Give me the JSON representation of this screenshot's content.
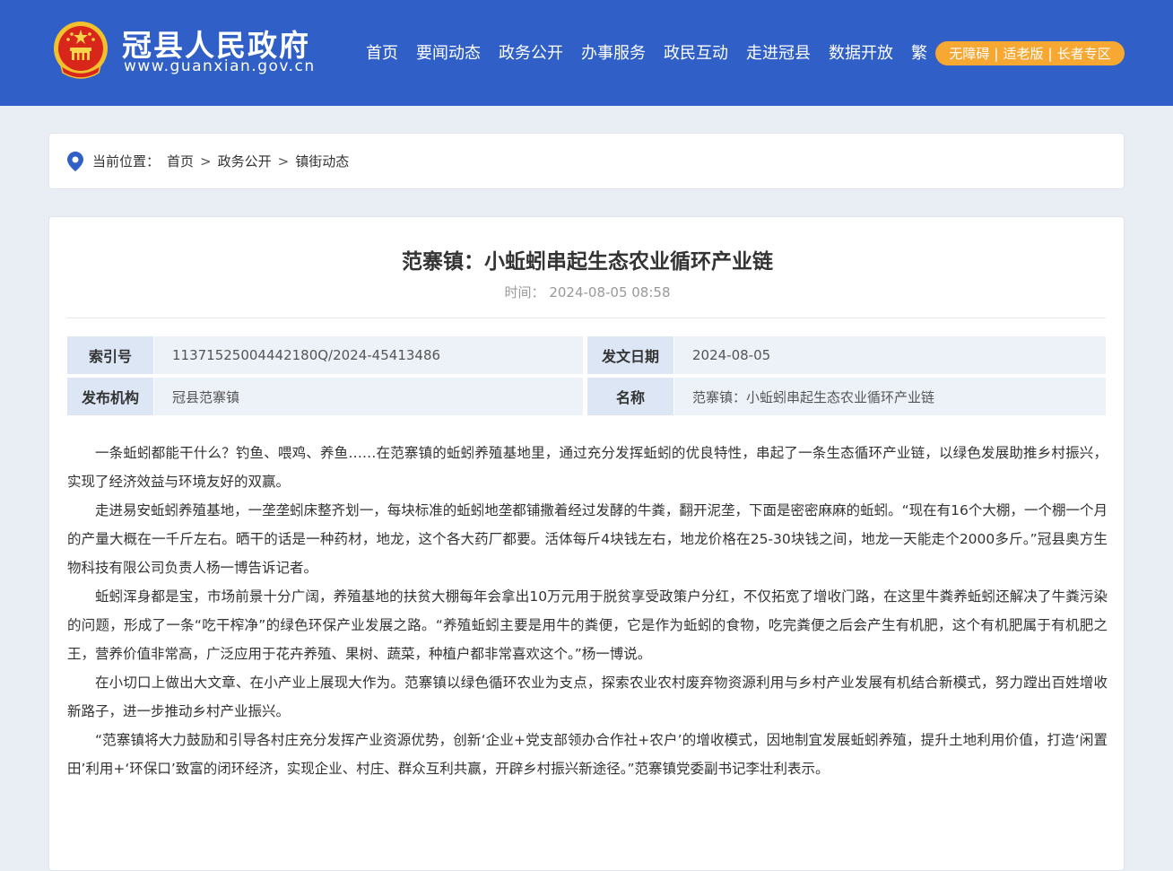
{
  "header": {
    "site_name": "冠县人民政府",
    "site_url": "www.guanxian.gov.cn",
    "nav": [
      "首页",
      "要闻动态",
      "政务公开",
      "办事服务",
      "政民互动",
      "走进冠县",
      "数据开放",
      "繁"
    ],
    "access": [
      "无障碍",
      "适老版",
      "长者专区"
    ],
    "access_sep": "|"
  },
  "breadcrumb": {
    "prefix": "当前位置：",
    "items": [
      "首页",
      "政务公开",
      "镇街动态"
    ],
    "sep": ">"
  },
  "article": {
    "title": "范寨镇：小蚯蚓串起生态农业循环产业链",
    "time_label": "时间：",
    "time_value": "2024-08-05 08:58",
    "meta": {
      "index_label": "索引号",
      "index_value": "11371525004442180Q/2024-45413486",
      "date_label": "发文日期",
      "date_value": "2024-08-05",
      "org_label": "发布机构",
      "org_value": "冠县范寨镇",
      "name_label": "名称",
      "name_value": "范寨镇：小蚯蚓串起生态农业循环产业链"
    },
    "paragraphs": [
      "一条蚯蚓都能干什么？钓鱼、喂鸡、养鱼……在范寨镇的蚯蚓养殖基地里，通过充分发挥蚯蚓的优良特性，串起了一条生态循环产业链，以绿色发展助推乡村振兴，实现了经济效益与环境友好的双赢。",
      "走进易安蚯蚓养殖基地，一垄垄蚓床整齐划一，每块标准的蚯蚓地垄都铺撒着经过发酵的牛粪，翻开泥垄，下面是密密麻麻的蚯蚓。“现在有16个大棚，一个棚一个月的产量大概在一千斤左右。晒干的话是一种药材，地龙，这个各大药厂都要。活体每斤4块钱左右，地龙价格在25-30块钱之间，地龙一天能走个2000多斤。”冠县奥方生物科技有限公司负责人杨一博告诉记者。",
      "蚯蚓浑身都是宝，市场前景十分广阔，养殖基地的扶贫大棚每年会拿出10万元用于脱贫享受政策户分红，不仅拓宽了增收门路，在这里牛粪养蚯蚓还解决了牛粪污染的问题，形成了一条“吃干榨净”的绿色环保产业发展之路。“养殖蚯蚓主要是用牛的粪便，它是作为蚯蚓的食物，吃完粪便之后会产生有机肥，这个有机肥属于有机肥之王，营养价值非常高，广泛应用于花卉养殖、果树、蔬菜，种植户都非常喜欢这个。”杨一博说。",
      "在小切口上做出大文章、在小产业上展现大作为。范寨镇以绿色循环农业为支点，探索农业农村废弃物资源利用与乡村产业发展有机结合新模式，努力蹚出百姓增收新路子，进一步推动乡村产业振兴。",
      "“范寨镇将大力鼓励和引导各村庄充分发挥产业资源优势，创新‘企业+党支部领办合作社+农户’的增收模式，因地制宜发展蚯蚓养殖，提升土地利用价值，打造‘闲置田’利用+‘环保口’致富的闭环经济，实现企业、村庄、群众互利共赢，开辟乡村振兴新途径。”范寨镇党委副书记李壮利表示。"
    ]
  }
}
